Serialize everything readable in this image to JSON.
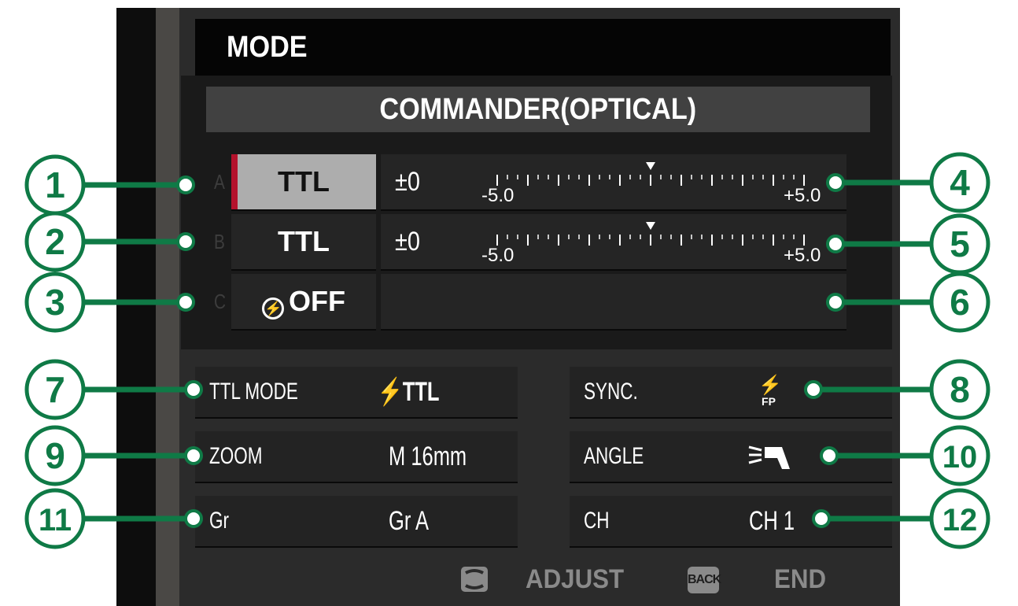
{
  "header": {
    "title": "MODE"
  },
  "mode": {
    "value": "COMMANDER(OPTICAL)"
  },
  "groups": [
    {
      "letter": "A",
      "mode": "TTL",
      "comp": "±0",
      "scale_min": "-5.0",
      "scale_max": "+5.0",
      "comp_value": 0,
      "selected": true
    },
    {
      "letter": "B",
      "mode": "TTL",
      "comp": "±0",
      "scale_min": "-5.0",
      "scale_max": "+5.0",
      "comp_value": 0,
      "selected": false
    },
    {
      "letter": "C",
      "mode": "OFF",
      "mode_icon": "flash-off-icon",
      "selected": false
    }
  ],
  "settings": {
    "ttl_mode": {
      "label": "TTL MODE",
      "value": "TTL",
      "value_icon": "flash-icon"
    },
    "sync": {
      "label": "SYNC.",
      "value_icon": "flash-fp-icon",
      "icon_text": "FP"
    },
    "zoom": {
      "label": "ZOOM",
      "value": "M 16mm"
    },
    "angle": {
      "label": "ANGLE",
      "value_icon": "flash-angle-icon"
    },
    "gr": {
      "label": "Gr",
      "value": "Gr A"
    },
    "ch": {
      "label": "CH",
      "value": "CH 1"
    }
  },
  "footer": {
    "adjust_label": "ADJUST",
    "adjust_icon": "dial-icon",
    "back_label": "BACK",
    "end_label": "END"
  },
  "callouts": [
    "1",
    "2",
    "3",
    "4",
    "5",
    "6",
    "7",
    "8",
    "9",
    "10",
    "11",
    "12"
  ],
  "colors": {
    "callout": "#0f7a46",
    "selected_bar": "#b4122c",
    "selected_bg": "#adadad"
  }
}
